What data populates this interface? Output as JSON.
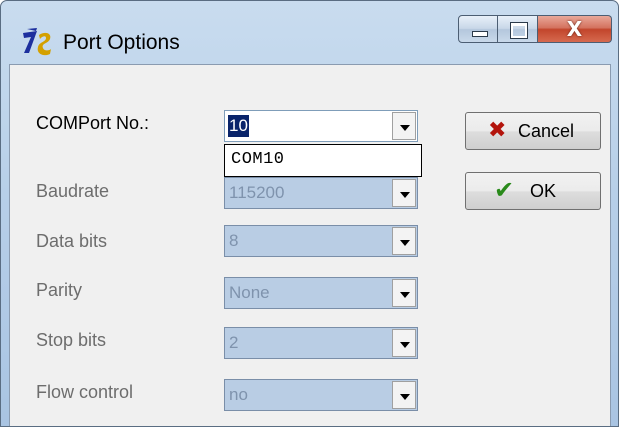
{
  "window": {
    "title": "Port Options",
    "app_icon": "zoc-app-icon",
    "caption_buttons": {
      "minimize": "minimize-icon",
      "maximize": "maximize-icon",
      "close": "close-icon",
      "close_glyph": "X"
    }
  },
  "form": {
    "comport": {
      "label": "COMPort No.:",
      "value": "10",
      "dropdown_options": [
        "COM10"
      ]
    },
    "baudrate": {
      "label": "Baudrate",
      "value": "115200"
    },
    "data_bits": {
      "label": "Data bits",
      "value": "8"
    },
    "parity": {
      "label": "Parity",
      "value": "None"
    },
    "stop_bits": {
      "label": "Stop bits",
      "value": "2"
    },
    "flow_control": {
      "label": "Flow control",
      "value": "no"
    }
  },
  "buttons": {
    "cancel": {
      "label": "Cancel",
      "icon": "red-x-icon"
    },
    "ok": {
      "label": "OK",
      "icon": "green-checkmark-icon"
    }
  },
  "colors": {
    "selection": "#0a246a",
    "disabled_field": "#b9cde4",
    "cancel_icon": "#b3140c",
    "ok_icon": "#2a8a1b"
  }
}
